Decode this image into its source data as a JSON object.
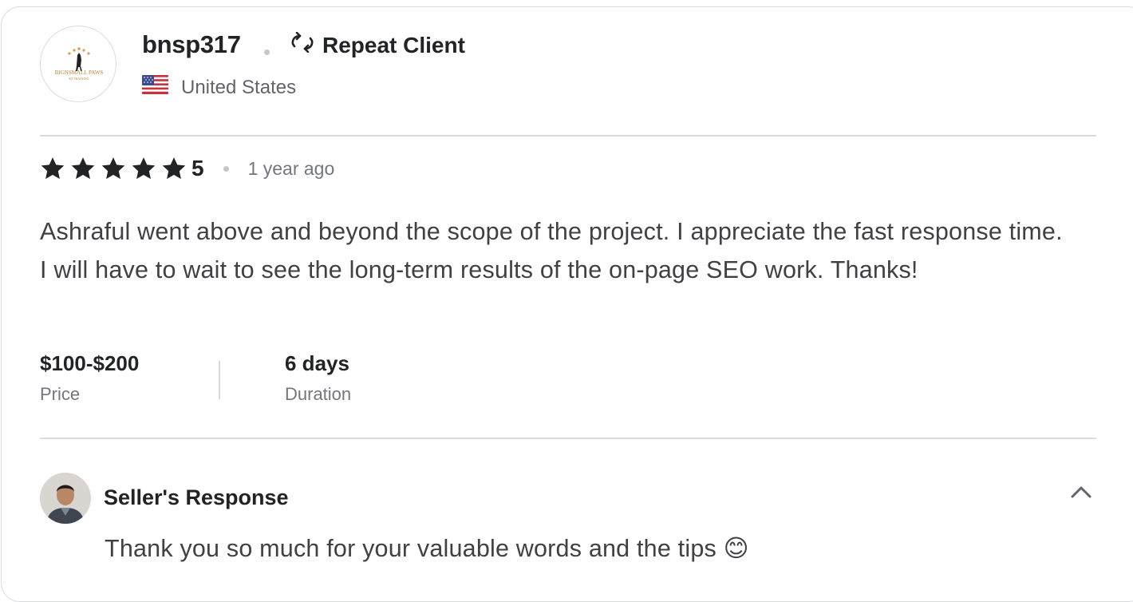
{
  "reviewer": {
    "username": "bnsp317",
    "badge_label": "Repeat Client",
    "country": "United States",
    "avatar_text": "BIGNSMALL PAWS",
    "avatar_subtext": "K9 TRAINING"
  },
  "review": {
    "rating": "5",
    "stars": 5,
    "time_ago": "1 year ago",
    "text": "Ashraful went above and beyond the scope of the project. I appreciate the fast response time. I will have to wait to see the long-term results of the on-page SEO work. Thanks!"
  },
  "meta": {
    "price_value": "$100-$200",
    "price_label": "Price",
    "duration_value": "6 days",
    "duration_label": "Duration"
  },
  "seller_response": {
    "title": "Seller's Response",
    "text": "Thank you so much for your valuable words and the tips 😊"
  },
  "colors": {
    "star": "#222325",
    "border": "#dadbdd",
    "muted": "#74767e"
  },
  "icons": [
    "repeat-icon",
    "us-flag-icon",
    "star-icon",
    "chevron-up-icon"
  ]
}
